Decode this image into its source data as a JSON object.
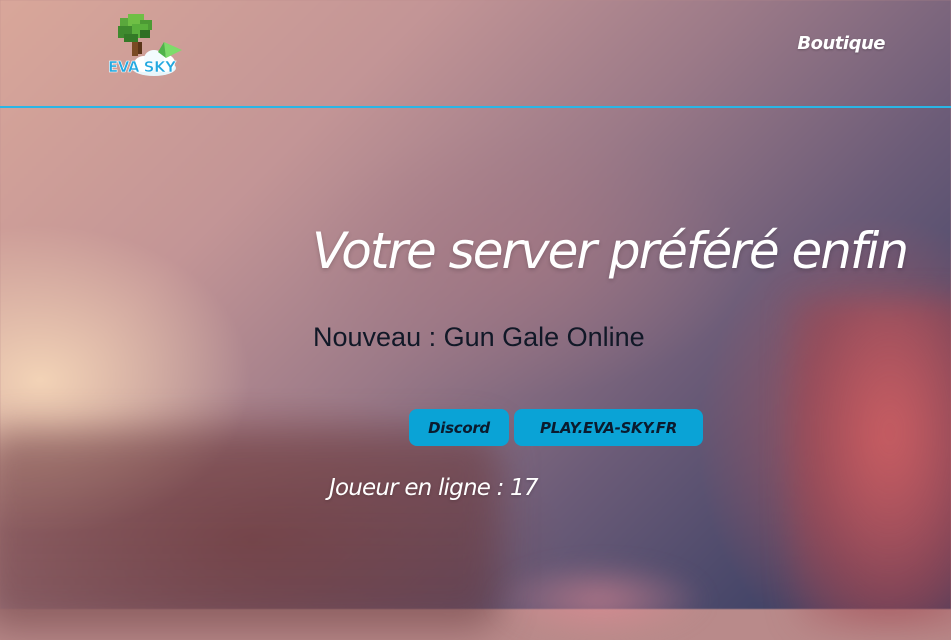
{
  "brand": {
    "logo_text": "EVA SKY"
  },
  "nav": {
    "links": [
      {
        "label": "Boutique"
      }
    ]
  },
  "hero": {
    "title": "Votre server préféré enfin",
    "subtitle": "Nouveau : Gun Gale Online"
  },
  "buttons": {
    "discord_label": "Discord",
    "ip_label": "PLAY.EVA-SKY.FR"
  },
  "status": {
    "players_label": "Joueur en ligne : ",
    "players_count": "17"
  },
  "colors": {
    "accent": "#29b6e6",
    "button_bg": "#0aa3d6",
    "button_text": "#0b1b2e",
    "subtitle_text": "#111827"
  }
}
